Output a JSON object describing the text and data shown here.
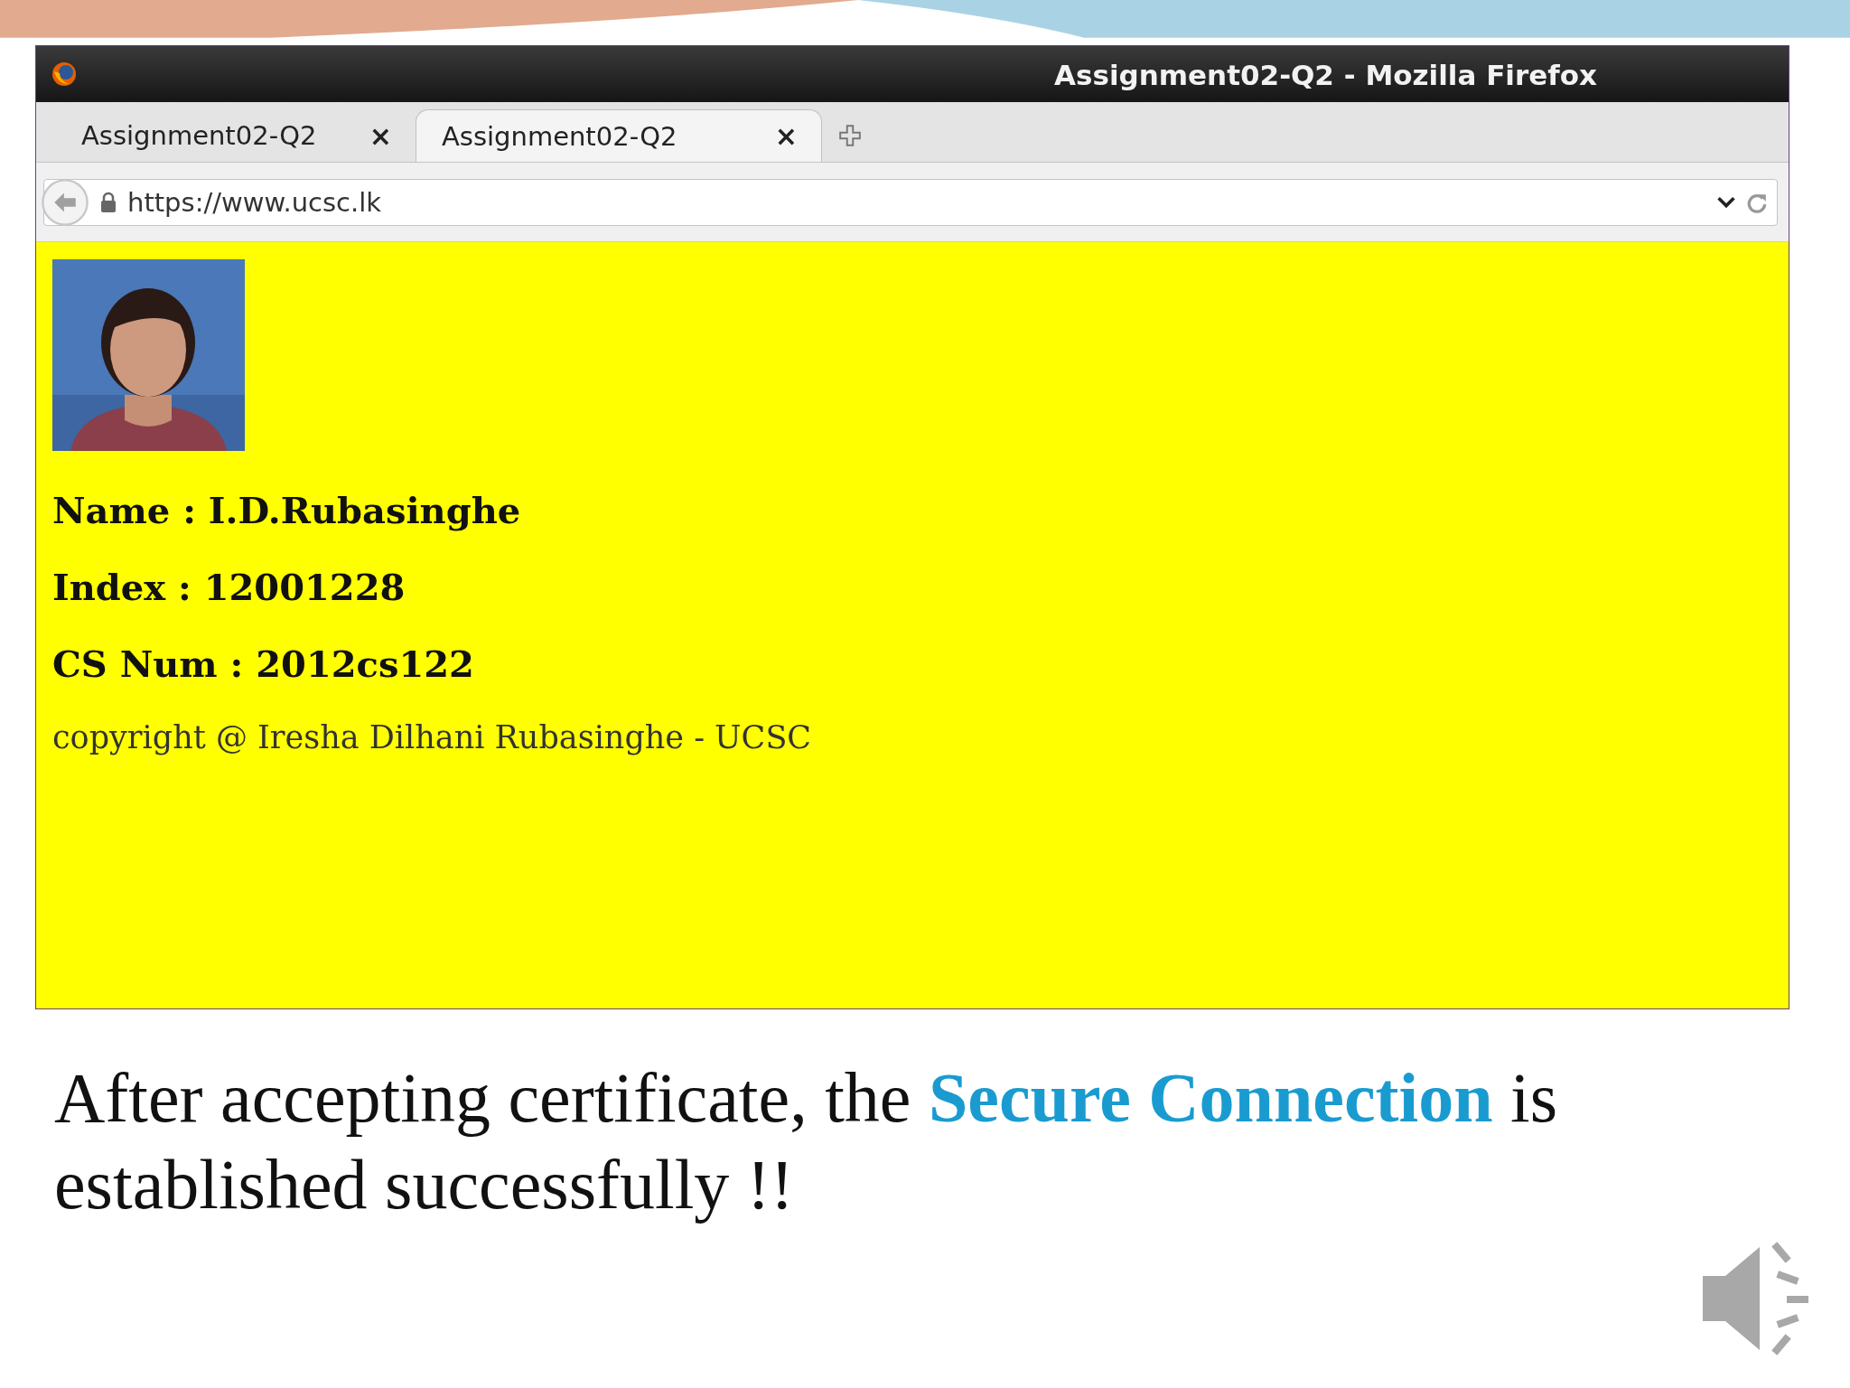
{
  "window": {
    "title": "Assignment02-Q2 - Mozilla Firefox"
  },
  "tabs": [
    {
      "label": "Assignment02-Q2",
      "close": "×",
      "selected": false
    },
    {
      "label": "Assignment02-Q2",
      "close": "×",
      "selected": true
    }
  ],
  "address_bar": {
    "url": "https://www.ucsc.lk"
  },
  "page": {
    "fields": [
      "Name : I.D.Rubasinghe",
      "Index : 12001228",
      "CS Num : 2012cs122"
    ],
    "copyright": "copyright @ Iresha Dilhani Rubasinghe - UCSC"
  },
  "caption": "After accepting certificate, the **Secure Connection** is established successfully !!"
}
